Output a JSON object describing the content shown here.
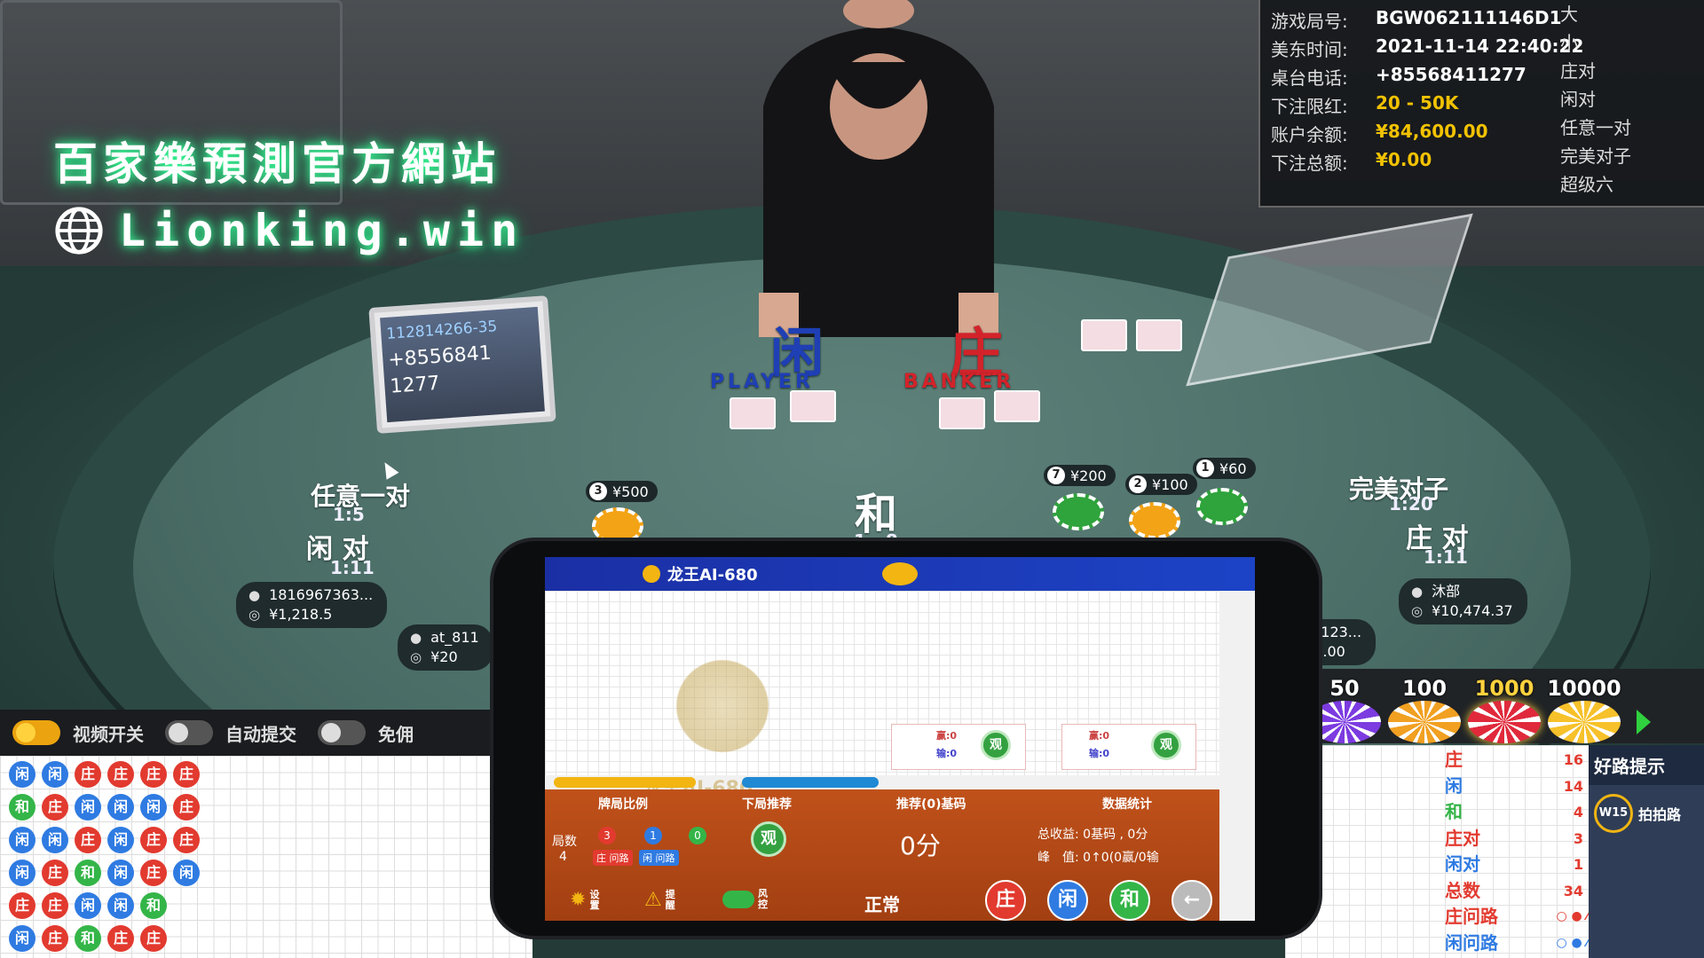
{
  "brand": {
    "line1": "百家樂預測官方網站",
    "line2": "Lionking.win"
  },
  "info": {
    "rows": [
      {
        "k": "游戏局号:",
        "v": "BGW062111146D1",
        "color": "#ffffff"
      },
      {
        "k": "美东时间:",
        "v": "2021-11-14 22:40:22",
        "color": "#ffffff"
      },
      {
        "k": "桌台电话:",
        "v": "+85568411277",
        "color": "#ffffff"
      },
      {
        "k": "下注限红:",
        "v": "20 - 50K",
        "color": "#f2c200"
      },
      {
        "k": "账户余额:",
        "v": "¥84,600.00",
        "color": "#f2c200"
      },
      {
        "k": "下注总额:",
        "v": "¥0.00",
        "color": "#f2c200"
      }
    ],
    "side_bets": [
      "大",
      "小",
      "庄对",
      "闲对",
      "任意一对",
      "完美对子",
      "超级六"
    ]
  },
  "tablet": {
    "line1": "112814266-35",
    "line2": "+8556841",
    "line3": "1277"
  },
  "zones": {
    "player_text": "闲",
    "player_en": "PLAYER",
    "banker_text": "庄",
    "banker_en": "BANKER",
    "any_pair": "任意一对",
    "any_pair_odds": "1:5",
    "player_pair": "闲 对",
    "player_pair_odds": "1:11",
    "tie": "和",
    "tie_odds": "1 : 8",
    "perfect_pair": "完美对子",
    "perfect_pair_odds": "1:20",
    "banker_pair": "庄 对",
    "banker_pair_odds": "1:11"
  },
  "chip_tags": [
    {
      "n": "3",
      "amount": "¥500"
    },
    {
      "n": "7",
      "amount": "¥200"
    },
    {
      "n": "2",
      "amount": "¥100"
    },
    {
      "n": "1",
      "amount": "¥60"
    }
  ],
  "seats": [
    {
      "name": "1816967363...",
      "amount": "¥1,218.5"
    },
    {
      "name": "at_811",
      "amount": "¥20"
    },
    {
      "name": "cy123...",
      "amount": "00.00"
    },
    {
      "name": "沐部",
      "amount": "¥10,474.37"
    }
  ],
  "toolbar": {
    "video": "视频开关",
    "auto": "自动提交",
    "free": "免佣"
  },
  "bead_road": [
    [
      "闲",
      "闲",
      "庄",
      "庄",
      "庄",
      "庄"
    ],
    [
      "和",
      "庄",
      "闲",
      "闲",
      "闲",
      "庄"
    ],
    [
      "闲",
      "闲",
      "庄",
      "闲",
      "庄",
      "庄"
    ],
    [
      "闲",
      "庄",
      "和",
      "闲",
      "庄",
      "闲"
    ],
    [
      "庄",
      "庄",
      "闲",
      "闲",
      "和",
      ""
    ],
    [
      "闲",
      "庄",
      "和",
      "庄",
      "庄",
      ""
    ]
  ],
  "chips": [
    "50",
    "100",
    "1000",
    "10000"
  ],
  "stats": [
    {
      "k": "庄",
      "v": "16",
      "color": "#e23a2f"
    },
    {
      "k": "闲",
      "v": "14",
      "color": "#2f7be2"
    },
    {
      "k": "和",
      "v": "4",
      "color": "#34b548"
    },
    {
      "k": "庄对",
      "v": "3",
      "color": "#e23a2f"
    },
    {
      "k": "闲对",
      "v": "1",
      "color": "#2f7be2"
    },
    {
      "k": "总数",
      "v": "34",
      "color": "#e23a2f"
    },
    {
      "k": "庄问路",
      "v": "",
      "color": "#e23a2f"
    },
    {
      "k": "闲问路",
      "v": "",
      "color": "#2f7be2"
    }
  ],
  "hint": {
    "title": "好路提示",
    "badge": "W15",
    "label": "拍拍路"
  },
  "phone": {
    "app_title": "龙王AI-680",
    "watermark": "龙王AI-680",
    "guan": "观",
    "box1_a": "赢:0",
    "box1_b": "输:0",
    "box2_a": "赢:0",
    "box2_b": "输:0",
    "col1": "牌局比例",
    "col2": "下局推荐",
    "col3": "推荐(0)基码",
    "col4": "数据统计",
    "rounds_label": "局数",
    "rounds": "4",
    "r_banker": "3",
    "r_player": "1",
    "r_tie": "0",
    "r_banker_lbl": "庄 问路",
    "r_player_lbl": "闲 问路",
    "score": "0分",
    "total_line": "总收益: 0基码 , 0分",
    "peak_line": "峰　值: 0↑0(0赢/0输",
    "settings": "设置",
    "alert": "提醒",
    "risk": "风控",
    "mode": "正常",
    "btn_banker": "庄",
    "btn_player": "闲",
    "btn_tie": "和"
  }
}
